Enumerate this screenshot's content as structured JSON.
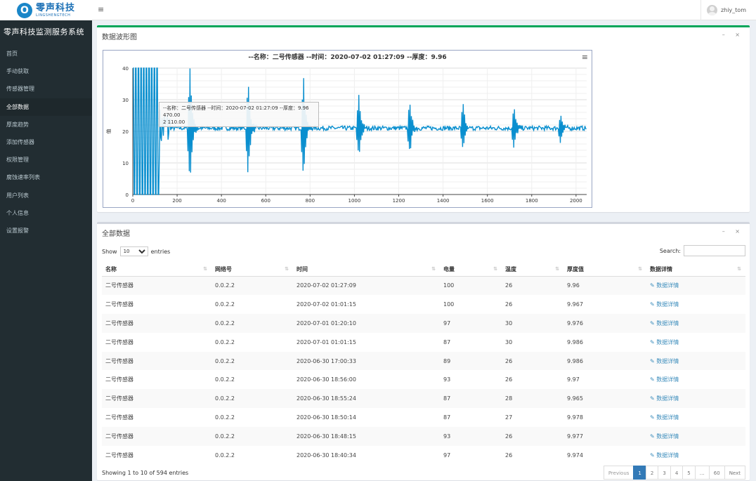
{
  "brand": {
    "logo_letter": "O",
    "name": "零声科技",
    "sub": "LINGSHENGTECH"
  },
  "topbar": {
    "menu_icon": "≡",
    "user": "zhiy_tom"
  },
  "sidebar": {
    "title": "零声科技监测服务系统",
    "items": [
      {
        "label": "首页"
      },
      {
        "label": "手动获取"
      },
      {
        "label": "传感器管理"
      },
      {
        "label": "全部数据",
        "active": true
      },
      {
        "label": "厚度趋势"
      },
      {
        "label": "添加传感器"
      },
      {
        "label": "权限管理"
      },
      {
        "label": "腐蚀速率列表"
      },
      {
        "label": "用户列表"
      },
      {
        "label": "个人信息"
      },
      {
        "label": "设置报警"
      }
    ]
  },
  "chart_panel": {
    "title": "数据波形图",
    "tools": "– ×"
  },
  "chart_data": {
    "type": "line",
    "title": "--名称：二号传感器 --时间：2020-07-02 01:27:09 --厚度：9.96",
    "ylabel": "值",
    "xlim": [
      0,
      2048
    ],
    "ylim": [
      0,
      40
    ],
    "xticks": [
      "0",
      "200",
      "400",
      "600",
      "800",
      "1000",
      "1200",
      "1400",
      "1600",
      "1800",
      "2000"
    ],
    "yticks": [
      "0",
      "10",
      "20",
      "30",
      "40"
    ],
    "baseline": 21,
    "bursts": [
      {
        "x": 258,
        "amp": 19
      },
      {
        "x": 520,
        "amp": 16
      },
      {
        "x": 770,
        "amp": 17
      },
      {
        "x": 1020,
        "amp": 10
      },
      {
        "x": 1250,
        "amp": 9
      },
      {
        "x": 1490,
        "amp": 8
      },
      {
        "x": 1720,
        "amp": 7
      },
      {
        "x": 1930,
        "amp": 5
      }
    ],
    "tooltip": {
      "line1": "--名称：二号传感器 --时间：2020-07-02 01:27:09 --厚度：9.96",
      "line2": "470.00",
      "line3": "2 110.00"
    }
  },
  "data_panel": {
    "title": "全部数据",
    "tools": "– ×"
  },
  "table_controls": {
    "show": "Show",
    "length": "10",
    "entries": "entries",
    "search_label": "Search:"
  },
  "table": {
    "columns": [
      "名称",
      "网络号",
      "时间",
      "电量",
      "温度",
      "厚度值",
      "数据详情"
    ],
    "rows": [
      [
        "二号传感器",
        "0.0.2.2",
        "2020-07-02 01:27:09",
        "100",
        "26",
        "9.96",
        "数据详情"
      ],
      [
        "二号传感器",
        "0.0.2.2",
        "2020-07-02 01:01:15",
        "100",
        "26",
        "9.967",
        "数据详情"
      ],
      [
        "二号传感器",
        "0.0.2.2",
        "2020-07-01 01:20:10",
        "97",
        "30",
        "9.976",
        "数据详情"
      ],
      [
        "二号传感器",
        "0.0.2.2",
        "2020-07-01 01:01:15",
        "87",
        "30",
        "9.986",
        "数据详情"
      ],
      [
        "二号传感器",
        "0.0.2.2",
        "2020-06-30 17:00:33",
        "89",
        "26",
        "9.986",
        "数据详情"
      ],
      [
        "二号传感器",
        "0.0.2.2",
        "2020-06-30 18:56:00",
        "93",
        "26",
        "9.97",
        "数据详情"
      ],
      [
        "二号传感器",
        "0.0.2.2",
        "2020-06-30 18:55:24",
        "87",
        "28",
        "9.965",
        "数据详情"
      ],
      [
        "二号传感器",
        "0.0.2.2",
        "2020-06-30 18:50:14",
        "87",
        "27",
        "9.978",
        "数据详情"
      ],
      [
        "二号传感器",
        "0.0.2.2",
        "2020-06-30 18:48:15",
        "93",
        "26",
        "9.977",
        "数据详情"
      ],
      [
        "二号传感器",
        "0.0.2.2",
        "2020-06-30 18:40:34",
        "97",
        "26",
        "9.974",
        "数据详情"
      ]
    ]
  },
  "footer": {
    "info": "Showing 1 to 10 of 594 entries",
    "pages": [
      "Previous",
      "1",
      "2",
      "3",
      "4",
      "5",
      "…",
      "60",
      "Next"
    ]
  },
  "colors": {
    "sidebar": "#222d32",
    "line": "#0a8fcf",
    "accent": "#00a65a"
  }
}
